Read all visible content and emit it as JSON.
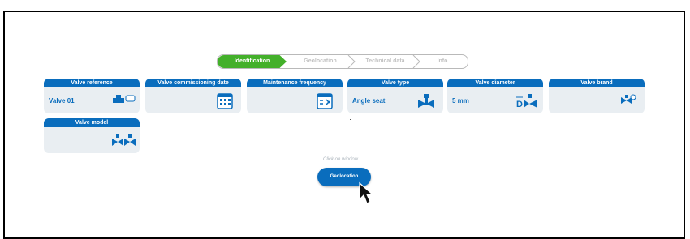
{
  "steps": [
    {
      "label": "Identification",
      "active": true
    },
    {
      "label": "Geolocation",
      "active": false
    },
    {
      "label": "Technical data",
      "active": false
    },
    {
      "label": "Info",
      "active": false
    }
  ],
  "cards": [
    {
      "title": "Valve reference",
      "value": "Valve 01",
      "icon": "valve-tag-icon"
    },
    {
      "title": "Valve commissioning date",
      "value": "",
      "icon": "calendar-grid-icon"
    },
    {
      "title": "Maintenance frequency",
      "value": "",
      "icon": "calendar-frequency-icon"
    },
    {
      "title": "Valve type",
      "value": "Angle seat",
      "icon": "angle-seat-valve-icon"
    },
    {
      "title": "Valve diameter",
      "value": "5 mm",
      "icon": "diameter-valve-icon"
    },
    {
      "title": "Valve brand",
      "value": "",
      "icon": "brand-valve-icon"
    },
    {
      "title": "Valve model",
      "value": "",
      "icon": "model-valve-icon"
    }
  ],
  "hint": "Click on window",
  "geolocation_button": "Geolocation",
  "colors": {
    "primary": "#0a6dbd",
    "active_step": "#43b02a",
    "card_bg": "#e9eef2"
  }
}
